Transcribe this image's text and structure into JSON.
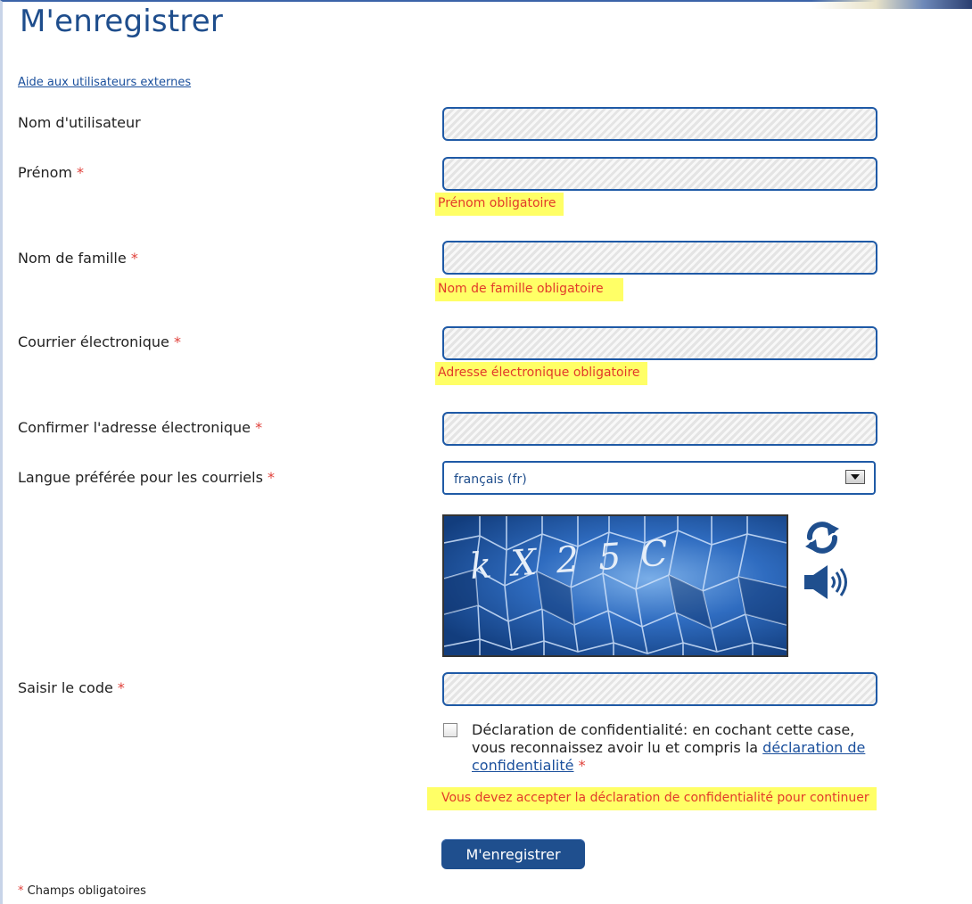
{
  "page": {
    "title": "M'enregistrer"
  },
  "help_link": "Aide aux utilisateurs externes",
  "required_marker": "*",
  "fields": {
    "username": {
      "label": "Nom d'utilisateur",
      "value": ""
    },
    "first_name": {
      "label": "Prénom",
      "value": "",
      "error": "Prénom obligatoire"
    },
    "last_name": {
      "label": "Nom de famille",
      "value": "",
      "error": "Nom de famille obligatoire"
    },
    "email": {
      "label": "Courrier électronique",
      "value": "",
      "error": "Adresse électronique obligatoire"
    },
    "email_confirm": {
      "label": "Confirmer l'adresse électronique",
      "value": ""
    },
    "language": {
      "label": "Langue préférée pour les courriels",
      "selected": "français (fr)"
    },
    "captcha_code": {
      "label": "Saisir le code",
      "value": ""
    }
  },
  "captcha": {
    "text": "kX25C",
    "refresh_icon": "refresh-icon",
    "audio_icon": "speaker-icon"
  },
  "privacy": {
    "text_before": "Déclaration de confidentialité: en cochant cette case, vous reconnaissez avoir lu et compris la ",
    "link": "déclaration de confidentialité",
    "checked": false,
    "error": "Vous devez accepter la déclaration de confidentialité pour continuer"
  },
  "submit_label": "M'enregistrer",
  "footnote": "Champs obligatoires",
  "colors": {
    "title": "#1e4d8c",
    "field_border": "#1f5aa6",
    "error_bg": "#ffff66",
    "error_text": "#e23a2a",
    "required": "#e0403a",
    "button_bg": "#1f4f8e"
  }
}
